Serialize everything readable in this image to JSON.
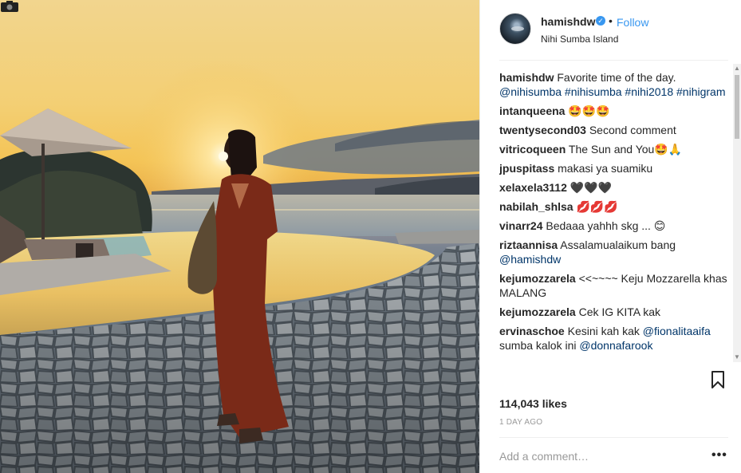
{
  "post": {
    "username": "hamishdw",
    "follow_label": "Follow",
    "location": "Nihi Sumba Island",
    "separator": "•",
    "likes": "114,043 likes",
    "time": "1 DAY AGO",
    "add_comment_placeholder": "Add a comment…",
    "more_label": "•••"
  },
  "caption": {
    "user": "hamishdw",
    "text": "Favorite time of the day.",
    "tags": "@nihisumba #nihisumba #nihi2018 #nihigram"
  },
  "comments": [
    {
      "user": "intanqueena",
      "text": "🤩🤩🤩"
    },
    {
      "user": "twentysecond03",
      "text": "Second comment"
    },
    {
      "user": "vitricoqueen",
      "text": "The Sun and You🤩🙏"
    },
    {
      "user": "jpuspitass",
      "text": "makasi ya suamiku"
    },
    {
      "user": "xelaxela3112",
      "text": "🖤🖤🖤"
    },
    {
      "user": "nabilah_shlsa",
      "text": "💋💋💋"
    },
    {
      "user": "vinarr24",
      "text": "Bedaaa yahhh skg ... 😊"
    },
    {
      "user": "riztaannisa",
      "text": "Assalamualaikum bang",
      "tag": "@hamishdw"
    },
    {
      "user": "kejumozzarela",
      "text": "<<~~~~ Keju Mozzarella khas MALANG"
    },
    {
      "user": "kejumozzarela",
      "text": "Cek IG KITA kak"
    },
    {
      "user": "ervinaschoe",
      "text": "Kesini kah kak",
      "tag": "@fionalitaaifa",
      "text2": "sumba kalok ini",
      "tag2": "@donnafarook"
    }
  ],
  "icons": {
    "verified": "verified-badge-icon",
    "bookmark": "bookmark-icon",
    "camera": "camera-icon",
    "more": "more-options-icon"
  },
  "colors": {
    "link_blue": "#3897f0",
    "tag_blue": "#003569",
    "muted": "#999999"
  }
}
